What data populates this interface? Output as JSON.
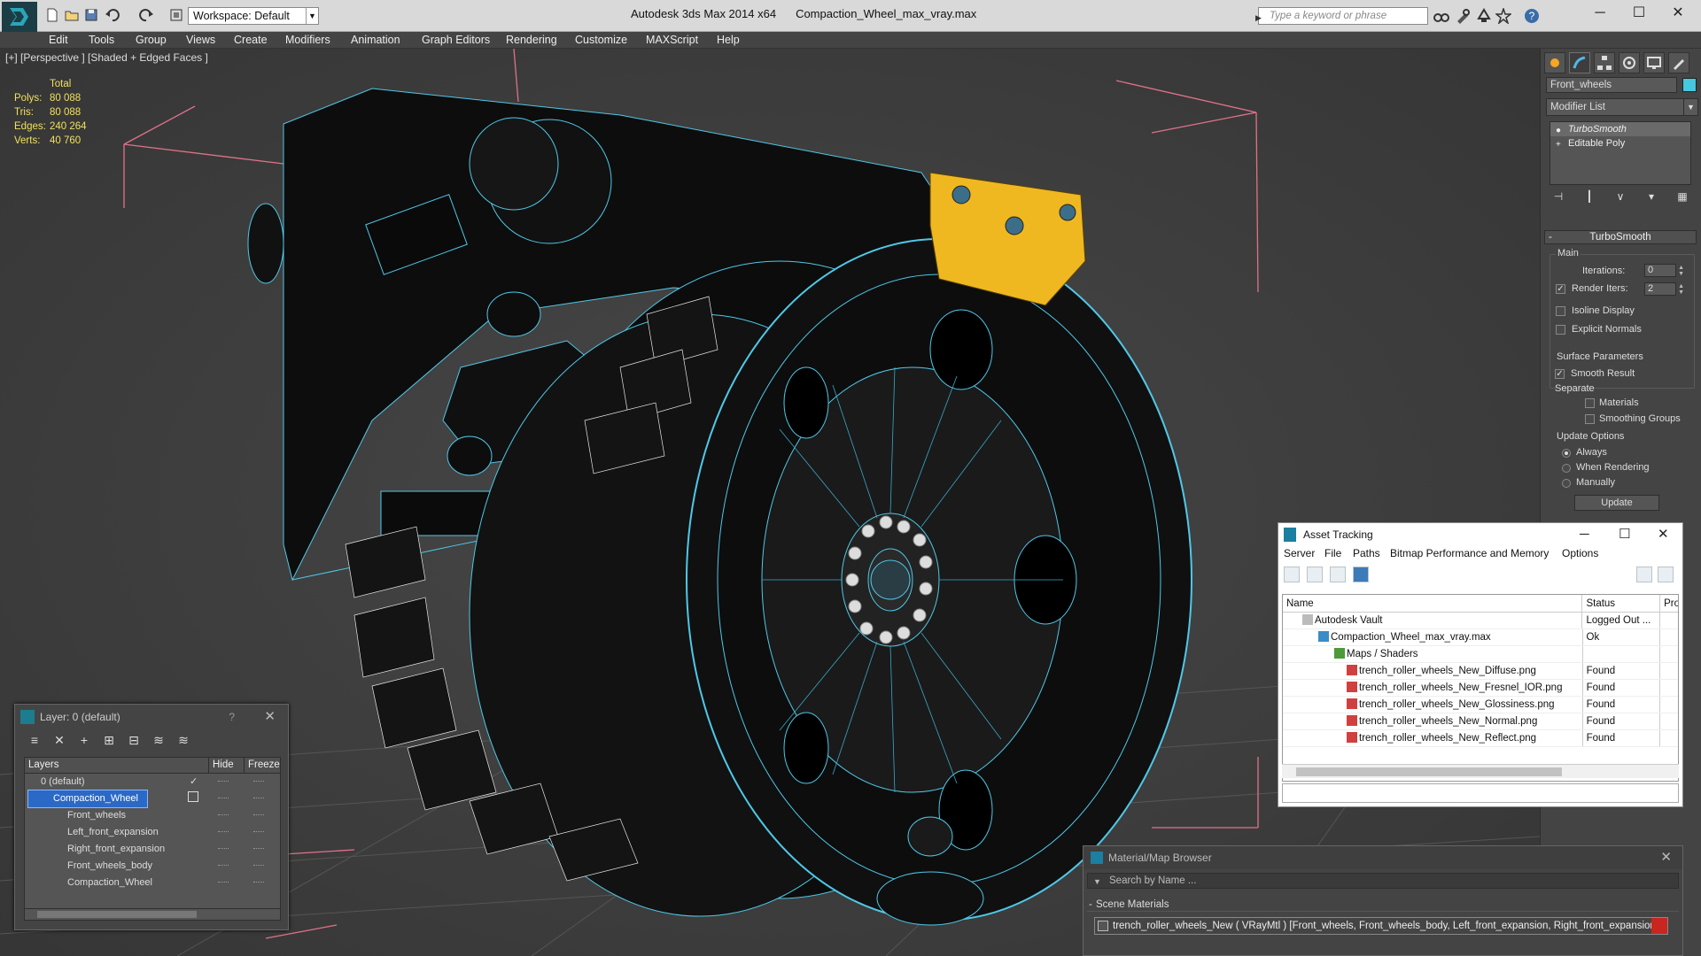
{
  "titlebar": {
    "workspace": "Workspace: Default",
    "app_name": "Autodesk 3ds Max  2014 x64",
    "file_name": "Compaction_Wheel_max_vray.max",
    "search_placeholder": "Type a keyword or phrase",
    "minimize": "─",
    "maximize": "☐",
    "close": "✕"
  },
  "menu": [
    "Edit",
    "Tools",
    "Group",
    "Views",
    "Create",
    "Modifiers",
    "Animation",
    "Graph Editors",
    "Rendering",
    "Customize",
    "MAXScript",
    "Help"
  ],
  "viewport": {
    "label": "[+] [Perspective ] [Shaded + Edged Faces ]",
    "stats": {
      "header": "Total",
      "polys_label": "Polys:",
      "polys": "80 088",
      "tris_label": "Tris:",
      "tris": "80 088",
      "edges_label": "Edges:",
      "edges": "240 264",
      "verts_label": "Verts:",
      "verts": "40 760"
    }
  },
  "command_panel": {
    "object_name": "Front_wheels",
    "object_color": "#46c8e0",
    "modifier_list": "Modifier List",
    "stack": [
      "TurboSmooth",
      "Editable Poly"
    ],
    "rollout_title": "TurboSmooth",
    "main_group": "Main",
    "iterations_label": "Iterations:",
    "iterations": "0",
    "render_iters_label": "Render Iters:",
    "render_iters": "2",
    "isoline": "Isoline Display",
    "explicit_normals": "Explicit Normals",
    "surface_group": "Surface Parameters",
    "smooth_result": "Smooth Result",
    "separate": "Separate",
    "materials": "Materials",
    "smoothing_groups": "Smoothing Groups",
    "update_group": "Update Options",
    "always": "Always",
    "when_rendering": "When Rendering",
    "manually": "Manually",
    "update_button": "Update"
  },
  "layer_window": {
    "title": "Layer: 0 (default)",
    "help": "?",
    "close": "✕",
    "col_layers": "Layers",
    "col_hide": "Hide",
    "col_freeze": "Freeze",
    "rows": [
      "0 (default)",
      "Compaction_Wheel",
      "Front_wheels",
      "Left_front_expansion",
      "Right_front_expansion",
      "Front_wheels_body",
      "Compaction_Wheel"
    ]
  },
  "asset_window": {
    "title": "Asset Tracking",
    "menu": [
      "Server",
      "File",
      "Paths",
      "Bitmap Performance and Memory",
      "Options"
    ],
    "col_name": "Name",
    "col_status": "Status",
    "col_pro": "Pro",
    "rows": [
      {
        "name": "Autodesk Vault",
        "status": "Logged Out ..."
      },
      {
        "name": "Compaction_Wheel_max_vray.max",
        "status": "Ok"
      },
      {
        "name": "Maps / Shaders",
        "status": ""
      },
      {
        "name": "trench_roller_wheels_New_Diffuse.png",
        "status": "Found"
      },
      {
        "name": "trench_roller_wheels_New_Fresnel_IOR.png",
        "status": "Found"
      },
      {
        "name": "trench_roller_wheels_New_Glossiness.png",
        "status": "Found"
      },
      {
        "name": "trench_roller_wheels_New_Normal.png",
        "status": "Found"
      },
      {
        "name": "trench_roller_wheels_New_Reflect.png",
        "status": "Found"
      }
    ]
  },
  "material_window": {
    "title": "Material/Map Browser",
    "close": "✕",
    "search_placeholder": "Search by Name ...",
    "section": "Scene Materials",
    "material": "trench_roller_wheels_New  ( VRayMtl ) [Front_wheels, Front_wheels_body, Left_front_expansion, Right_front_expansion]"
  }
}
